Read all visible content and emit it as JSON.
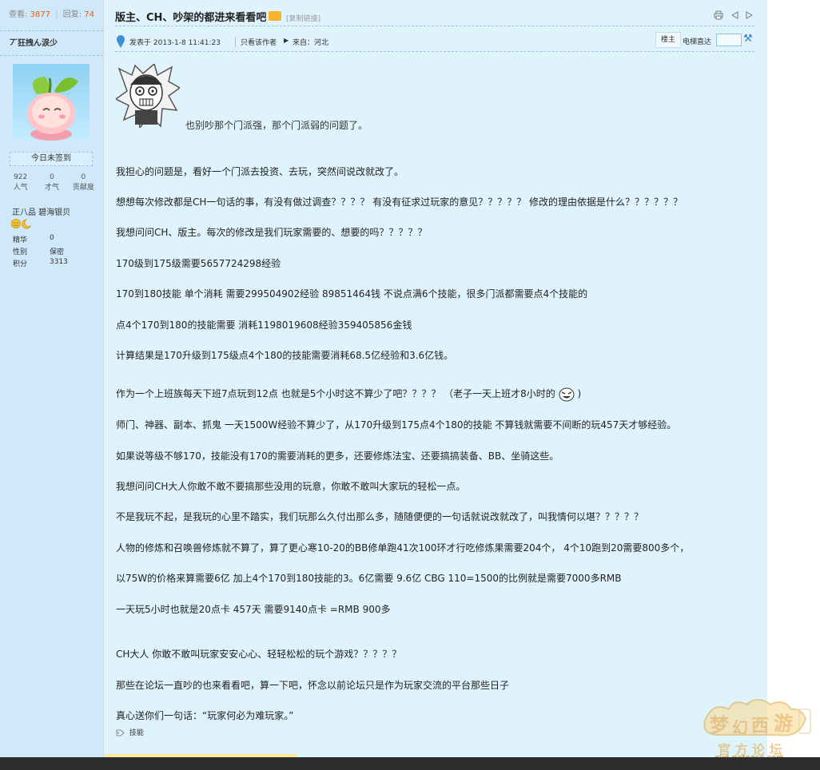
{
  "sidebar": {
    "views_label": "查看:",
    "views": "3877",
    "replies_label": "回复:",
    "replies": "74",
    "username": "丆狂拽ん涙少",
    "checkin": "今日未签到",
    "stats": [
      {
        "value": "922",
        "label": "人气"
      },
      {
        "value": "0",
        "label": "才气"
      },
      {
        "value": "0",
        "label": "贡献度"
      }
    ],
    "rank": "正八品 碧海银贝",
    "info": [
      {
        "key": "精华",
        "value": "0"
      },
      {
        "key": "性别",
        "value": "保密"
      },
      {
        "key": "积分",
        "value": "3313"
      }
    ]
  },
  "thread": {
    "title": "版主、CH、吵架的都进来看看吧",
    "copy_link": "[复制链接]",
    "tools_icons": [
      "print-icon",
      "prev-icon",
      "next-icon"
    ]
  },
  "meta": {
    "posted": "发表于 2013-1-8 11:41:23",
    "only_author": "只看该作者",
    "from": "来自：河北",
    "floor": "楼主",
    "elevator": "电梯直达"
  },
  "post": {
    "first_line": "也别吵那个门派强，那个门派弱的问题了。",
    "paragraphs": [
      "我担心的问题是，看好一个门派去投资、去玩，突然间说改就改了。",
      "想想每次修改都是CH一句话的事，有没有做过调查？？？？ 有没有征求过玩家的意见？？？？？ 修改的理由依据是什么？？？？？？",
      "我想问问CH、版主。每次的修改是我们玩家需要的、想要的吗？？？？？",
      "170级到175级需要5657724298经验",
      "170到180技能 单个消耗  需要299504902经验  89851464钱   不说点满6个技能，很多门派都需要点4个技能的",
      "点4个170到180的技能需要 消耗1198019608经验359405856金钱",
      "计算结果是170升级到175级点4个180的技能需要消耗68.5亿经验和3.6亿钱。",
      "作为一个上班族每天下班7点玩到12点 也就是5个小时这不算少了吧？？？？      （老子一天上班才8小时的",
      "师门、神器、副本、抓鬼  一天1500W经验不算少了，从170升级到175点4个180的技能 不算钱就需要不间断的玩457天才够经验。",
      "如果说等级不够170，技能没有170的需要消耗的更多，还要修炼法宝、还要搞搞装备、BB、坐骑这些。",
      "我想问问CH大人你敢不敢不要搞那些没用的玩意，你敢不敢叫大家玩的轻松一点。",
      "不是我玩不起，是我玩的心里不踏实，我们玩那么久付出那么多，随随便便的一句话就说改就改了，叫我情何以堪？？？？？",
      "人物的修炼和召唤兽修炼就不算了，算了更心寒10-20的BB修单跑41次100环才行吃修炼果需要204个，  4个10跑到20需要800多个，",
      "以75W的价格来算需要6亿  加上4个170到180技能的3。6亿需要   9.6亿  CBG 110=1500的比例就是需要7000多RMB",
      "一天玩5小时也就是20点卡 457天 需要9140点卡   =RMB 900多",
      "CH大人 你敢不敢叫玩家安安心心、轻轻松松的玩个游戏？？？？？",
      "那些在论坛一直吵的也来看看吧，算一下吧，怀念以前论坛只是作为玩家交流的平台那些日子",
      "真心送你们一句话：“玩家何必为难玩家。”"
    ],
    "paren_close": ")"
  },
  "tags_label": "技能",
  "logo": {
    "url": "xyq.netease.com"
  }
}
